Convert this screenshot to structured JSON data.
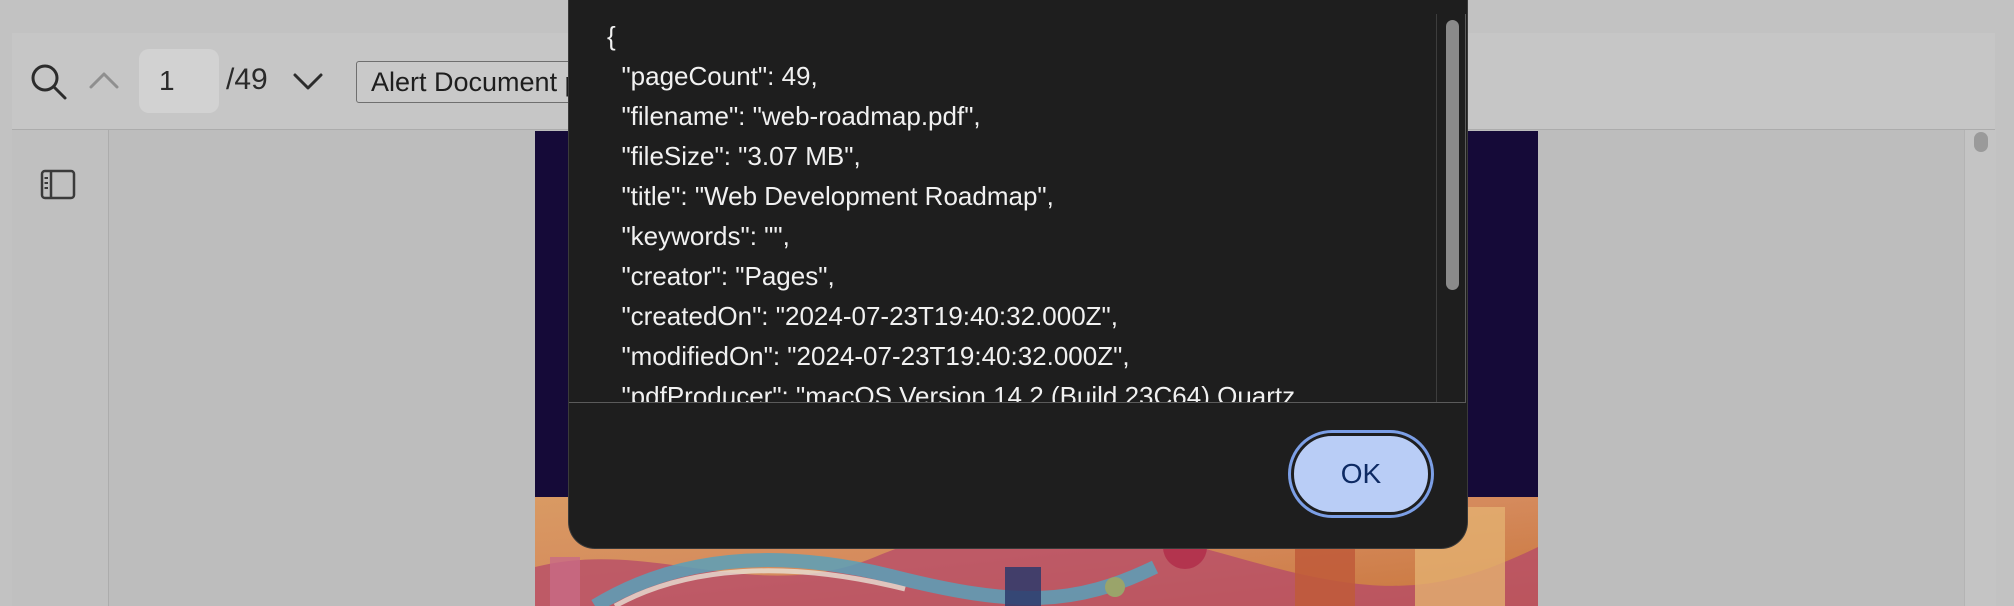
{
  "toolbar": {
    "page_number": "1",
    "page_total": "/49",
    "document_select_value": "Alert Document p"
  },
  "dialog": {
    "lines": [
      "{",
      "  \"pageCount\": 49,",
      "  \"filename\": \"web-roadmap.pdf\",",
      "  \"fileSize\": \"3.07 MB\",",
      "  \"title\": \"Web Development Roadmap\",",
      "  \"keywords\": \"\",",
      "  \"creator\": \"Pages\",",
      "  \"createdOn\": \"2024-07-23T19:40:32.000Z\",",
      "  \"modifiedOn\": \"2024-07-23T19:40:32.000Z\",",
      "  \"pdfProducer\": \"macOS Version 14.2 (Build 23C64) Quartz"
    ],
    "ok_label": "OK"
  },
  "icons": {
    "search": "search-icon",
    "prev": "chevron-up-icon",
    "next": "chevron-down-icon",
    "sidebar": "sidebar-toggle-icon"
  },
  "colors": {
    "dialog_bg": "#1e1e1e",
    "ok_button_bg": "#b9cdf6",
    "ok_button_ring": "#7c9fe6",
    "page_banner": "#150a38"
  }
}
